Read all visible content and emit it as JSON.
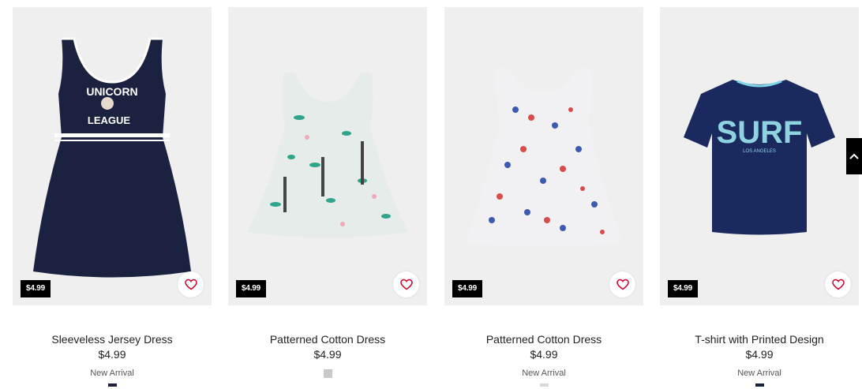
{
  "products": [
    {
      "name": "Sleeveless Jersey Dress",
      "price": "$4.99",
      "badge_price": "$4.99",
      "tag": "New Arrival",
      "swatch_color": "#1b2240"
    },
    {
      "name": "Patterned Cotton Dress",
      "price": "$4.99",
      "badge_price": "$4.99",
      "tag": "",
      "swatch_color": "#c8c8c8"
    },
    {
      "name": "Patterned Cotton Dress",
      "price": "$4.99",
      "badge_price": "$4.99",
      "tag": "New Arrival",
      "swatch_color": "#d8d8d8"
    },
    {
      "name": "T-shirt with Printed Design",
      "price": "$4.99",
      "badge_price": "$4.99",
      "tag": "New Arrival",
      "swatch_color": "#1b2240"
    }
  ],
  "print_text": {
    "unicorn_line1": "UNICORN",
    "unicorn_line2": "LEAGUE",
    "surf_main": "SURF",
    "surf_sub": "LOS ANGELES"
  },
  "icons": {
    "favorite": "heart-outline-icon",
    "scroll": "chevron-up-icon"
  },
  "colors": {
    "accent": "#d6002a",
    "badge_bg": "#000000",
    "navy": "#1b2240"
  }
}
